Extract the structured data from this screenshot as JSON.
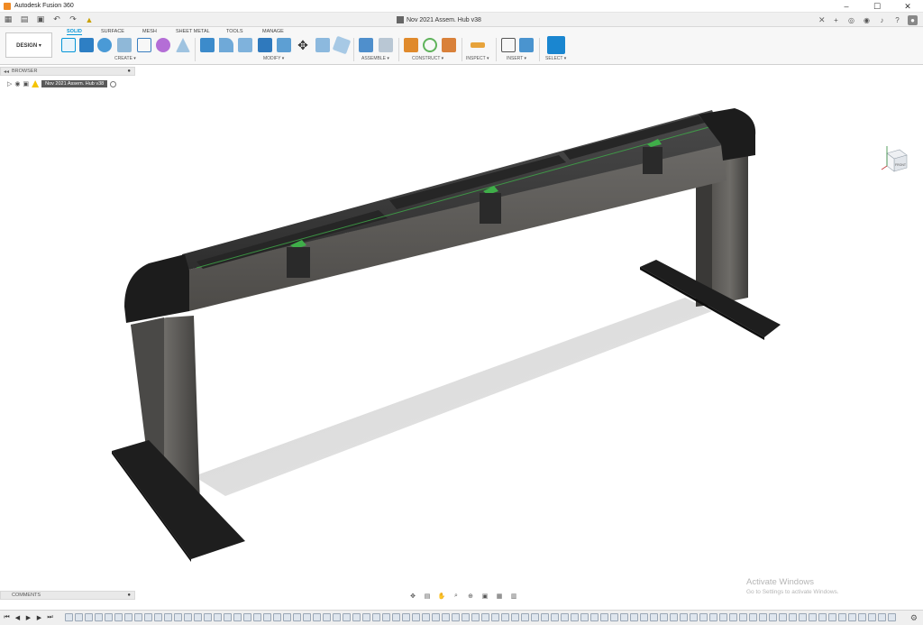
{
  "window": {
    "title": "Autodesk Fusion 360",
    "controls": [
      "–",
      "☐",
      "✕"
    ]
  },
  "document": {
    "tab_title": "Nov 2021 Assem. Hub v38"
  },
  "workspace": {
    "label": "DESIGN ▾"
  },
  "ribbon": {
    "tabs": [
      "SOLID",
      "SURFACE",
      "MESH",
      "SHEET METAL",
      "TOOLS",
      "MANAGE"
    ],
    "active_tab": "SOLID",
    "groups": [
      "CREATE ▾",
      "MODIFY ▾",
      "ASSEMBLE ▾",
      "CONSTRUCT ▾",
      "INSPECT ▾",
      "INSERT ▾",
      "SELECT ▾"
    ]
  },
  "browser": {
    "label": "BROWSER",
    "root_component": "Nov 2021 Assem. Hub v38"
  },
  "comments": {
    "label": "COMMENTS"
  },
  "viewcube": {
    "face": "FRONT"
  },
  "watermark": {
    "line1": "Activate Windows",
    "line2": "Go to Settings to activate Windows."
  },
  "colors": {
    "accent": "#0696d7",
    "frame": "#3a3a3a",
    "caps": "#1c1c1c",
    "green_accent": "#3fae49"
  }
}
